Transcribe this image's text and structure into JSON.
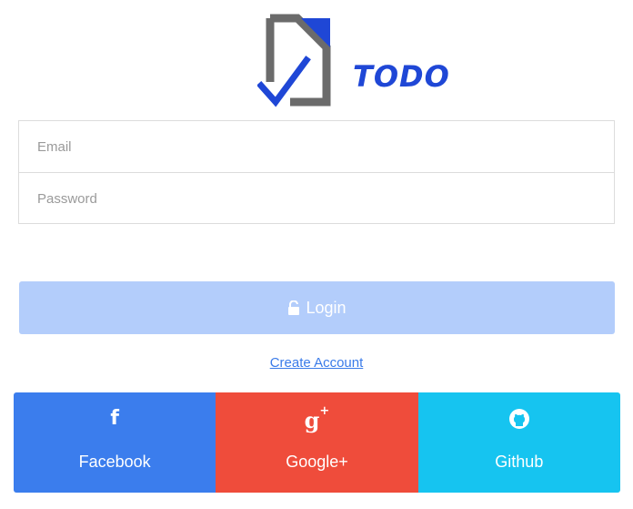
{
  "logo": {
    "text": "TODO"
  },
  "form": {
    "email_placeholder": "Email",
    "password_placeholder": "Password"
  },
  "login": {
    "label": "Login",
    "icon": "lock-icon"
  },
  "create_account": {
    "label": "Create Account"
  },
  "social": {
    "facebook": {
      "label": "Facebook",
      "icon": "facebook-icon",
      "color": "#3b7ded"
    },
    "google": {
      "label": "Google+",
      "icon": "google-plus-icon",
      "color": "#ef4c3b"
    },
    "github": {
      "label": "Github",
      "icon": "github-icon",
      "color": "#16c4f0"
    }
  },
  "colors": {
    "brand": "#1f47d6",
    "login_disabled": "#b3cdfb",
    "link": "#3a7be9"
  }
}
